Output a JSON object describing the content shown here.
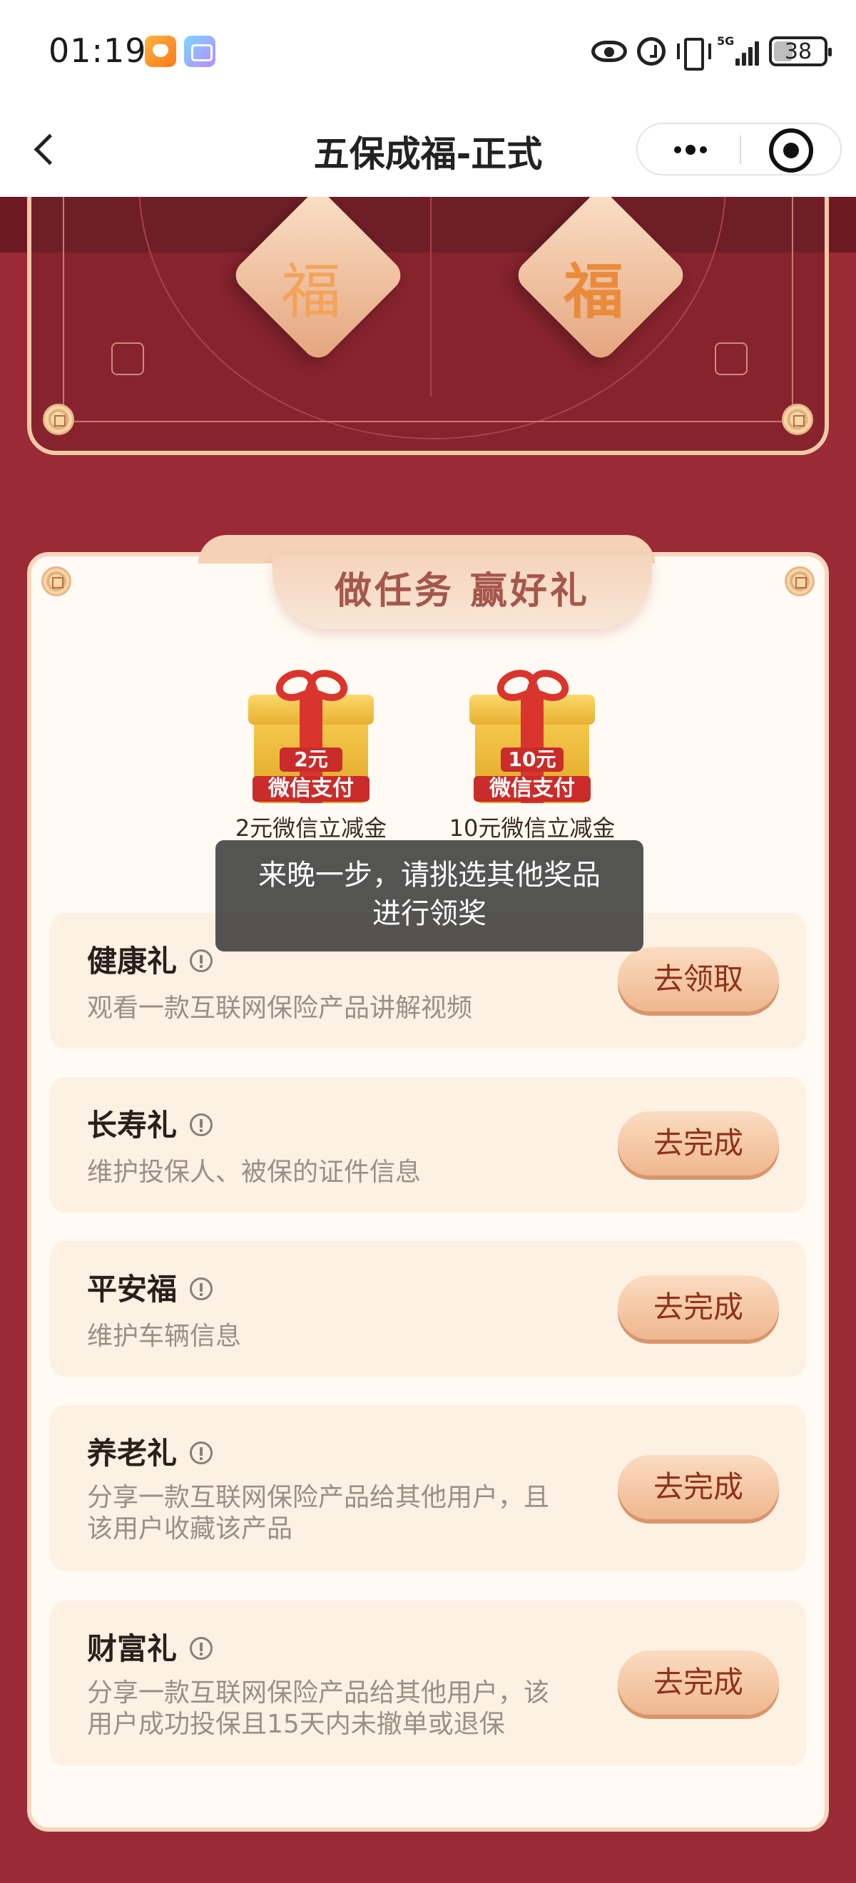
{
  "status_bar": {
    "time": "01:19",
    "network": "5G",
    "battery": "38",
    "battery_level": 0.38
  },
  "nav": {
    "title": "五保成福-正式"
  },
  "banner": {
    "fu_left": "福",
    "fu_right": "福"
  },
  "card": {
    "title": "做任务 赢好礼",
    "prizes": [
      {
        "amount": "2元",
        "pay": "微信支付",
        "label": "2元微信立减金"
      },
      {
        "amount": "10元",
        "pay": "微信支付",
        "label": "10元微信立减金"
      }
    ],
    "toast": {
      "line1": "来晚一步，请挑选其他奖品",
      "line2": "进行领奖"
    },
    "tasks": [
      {
        "name": "健康礼",
        "desc1": "观看一款互联网保险产品讲解视频",
        "desc2": "",
        "button": "去领取"
      },
      {
        "name": "长寿礼",
        "desc1": "维护投保人、被保的证件信息",
        "desc2": "",
        "button": "去完成"
      },
      {
        "name": "平安福",
        "desc1": "维护车辆信息",
        "desc2": "",
        "button": "去完成"
      },
      {
        "name": "养老礼",
        "desc1": "分享一款互联网保险产品给其他用户，且",
        "desc2": "该用户收藏该产品",
        "button": "去完成"
      },
      {
        "name": "财富礼",
        "desc1": "分享一款互联网保险产品给其他用户，该",
        "desc2": "用户成功投保且15天内未撤单或退保",
        "button": "去完成"
      }
    ]
  },
  "colors": {
    "background": "#9a2a36",
    "card": "#fffaf3",
    "task_bg": "#fdf1e3",
    "button_text": "#8f3218",
    "title_text": "#a5574c"
  }
}
